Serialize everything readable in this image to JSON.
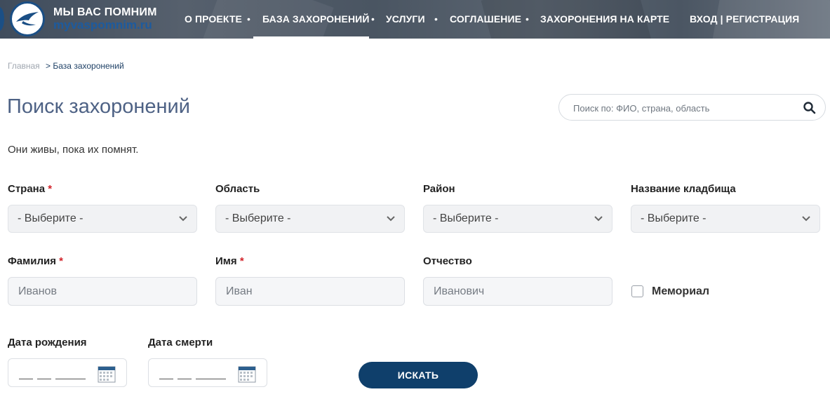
{
  "header": {
    "brand_title": "МЫ ВАС ПОМНИМ",
    "brand_url": "myvaspomnim.ru",
    "nav": [
      {
        "label": "О ПРОЕКТЕ"
      },
      {
        "label": "БАЗА ЗАХОРОНЕНИЙ",
        "active": true
      },
      {
        "label": "УСЛУГИ"
      },
      {
        "label": "СОГЛАШЕНИЕ"
      },
      {
        "label": "ЗАХОРОНЕНИЯ НА КАРТЕ"
      }
    ],
    "login_label": "ВХОД | РЕГИСТРАЦИЯ",
    "nav_separator": "•"
  },
  "breadcrumb": {
    "home": "Главная",
    "separator": ">",
    "current": "База захоронений"
  },
  "page_title": "Поиск захоронений",
  "search": {
    "placeholder": "Поиск по: ФИО, страна, область"
  },
  "subtitle": "Они живы, пока их помнят.",
  "required_mark": "*",
  "filters": {
    "country": {
      "label": "Страна",
      "value": "- Выберите -"
    },
    "region": {
      "label": "Область",
      "value": "- Выберите -"
    },
    "district": {
      "label": "Район",
      "value": "- Выберите -"
    },
    "cemetery": {
      "label": "Название кладбища",
      "value": "- Выберите -"
    }
  },
  "fields": {
    "surname": {
      "label": "Фамилия",
      "placeholder": "Иванов"
    },
    "name": {
      "label": "Имя",
      "placeholder": "Иван"
    },
    "patronymic": {
      "label": "Отчество",
      "placeholder": "Иванович"
    },
    "memorial": {
      "label": "Мемориал",
      "checked": false
    }
  },
  "dates": {
    "birth_label": "Дата рождения",
    "death_label": "Дата смерти"
  },
  "submit_label": "ИСКАТЬ",
  "colors": {
    "accent": "#0f3f6b",
    "title": "#4e6285",
    "required": "#d2232a"
  }
}
